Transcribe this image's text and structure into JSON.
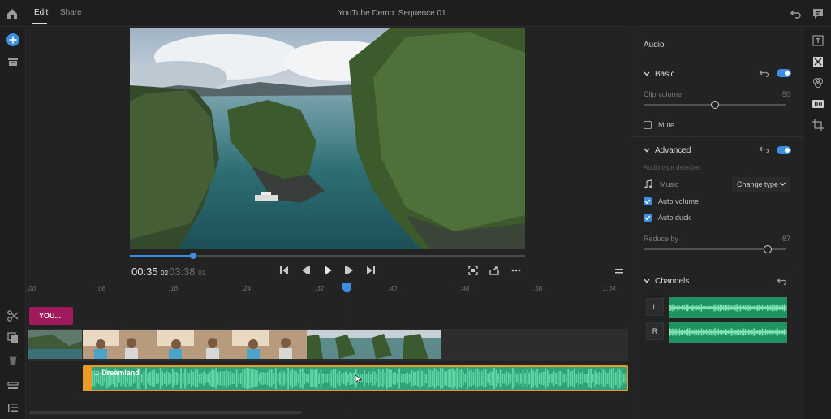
{
  "header": {
    "tabs": [
      {
        "label": "Edit",
        "active": true
      },
      {
        "label": "Share",
        "active": false
      }
    ],
    "title": "YouTube Demo: Sequence 01"
  },
  "icons": {
    "home": "home-icon",
    "undo": "undo-icon",
    "feedback": "chat-bubble-icon",
    "add": "add-circle-icon",
    "media": "media-bin-icon",
    "scissors": "scissors-icon",
    "duplicate": "duplicate-icon",
    "trash": "trash-icon",
    "track_settings": "track-settings-icon",
    "list": "list-icon"
  },
  "player": {
    "current_time": "00:35",
    "current_frames": "02",
    "total_time": "03:38",
    "total_frames": "01",
    "progress": 0.16
  },
  "timeline": {
    "ruler": [
      ":00",
      ":08",
      ":16",
      ":24",
      ":32",
      ":40",
      ":48",
      ":56",
      "1:04"
    ],
    "title_clip": "YOU...",
    "audio_clip": "Dreamland"
  },
  "audio_panel": {
    "title": "Audio",
    "basic": {
      "label": "Basic",
      "clip_volume_label": "Clip volume",
      "clip_volume_value": "50",
      "clip_volume_fraction": 0.5,
      "mute_label": "Mute",
      "mute_checked": false
    },
    "advanced": {
      "label": "Advanced",
      "detected_label": "Audio type detected",
      "type_label": "Music",
      "change_type_label": "Change type",
      "auto_volume_label": "Auto volume",
      "auto_volume_checked": true,
      "auto_duck_label": "Auto duck",
      "auto_duck_checked": true,
      "reduce_by_label": "Reduce by",
      "reduce_by_value": "87",
      "reduce_by_fraction": 0.87
    },
    "channels": {
      "label": "Channels",
      "left": "L",
      "right": "R"
    }
  },
  "colors": {
    "accent": "#3d8ee0",
    "title_clip": "#a0195b",
    "audio_wave": "#2fa27a",
    "audio_handle": "#e99b2a"
  }
}
